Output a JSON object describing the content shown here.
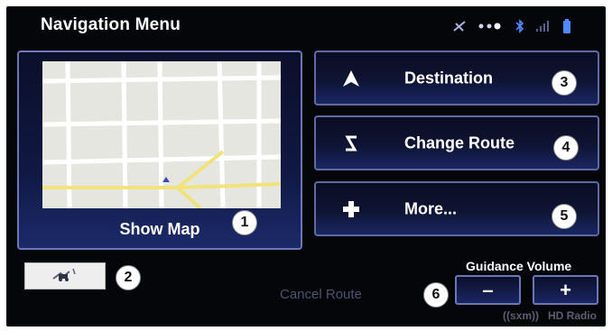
{
  "header": {
    "title": "Navigation Menu",
    "status_icons": [
      "satellite-icon",
      "signal-dots-icon",
      "bluetooth-icon",
      "cell-signal-icon",
      "battery-icon"
    ]
  },
  "map_panel": {
    "label": "Show Map",
    "callout": "1"
  },
  "recent_button": {
    "icon": "vehicle-route-icon",
    "callout": "2"
  },
  "menu": [
    {
      "label": "Destination",
      "icon": "arrow-up-icon",
      "callout": "3"
    },
    {
      "label": "Change Route",
      "icon": "route-s-icon",
      "callout": "4"
    },
    {
      "label": "More...",
      "icon": "plus-icon",
      "callout": "5"
    }
  ],
  "footer": {
    "cancel_route": "Cancel Route",
    "guidance_volume": "Guidance Volume",
    "volume_down": "–",
    "volume_up": "+",
    "callout": "6",
    "brand_1": "((sxm))",
    "brand_2": "HD Radio"
  },
  "colors": {
    "background": "#05060a",
    "button_border": "#6a78b8",
    "button_bottom": "#1a2663",
    "map_road": "#ffffff",
    "map_highway": "#f2e27a"
  }
}
